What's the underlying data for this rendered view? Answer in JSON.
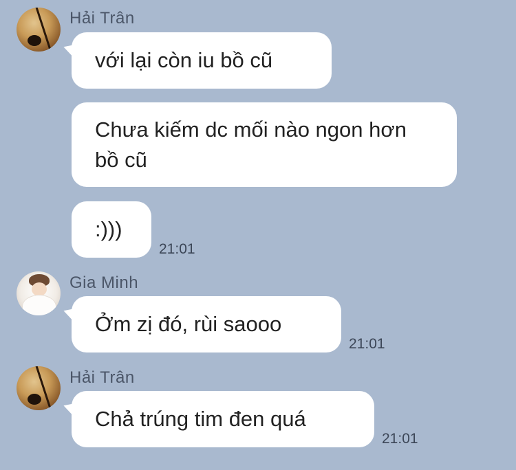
{
  "messages": [
    {
      "sender": "Hải Trân",
      "text": "với lại còn iu bồ cũ"
    },
    {
      "text": "Chưa kiếm dc mối nào ngon hơn bồ cũ"
    },
    {
      "text": ":)))",
      "time": "21:01"
    },
    {
      "sender": "Gia Minh",
      "text": "Ởm zị đó, rùi saooo",
      "time": "21:01"
    },
    {
      "sender": "Hải Trân",
      "text": "Chả trúng tim đen quá",
      "time": "21:01"
    }
  ],
  "avatars": {
    "hai_tran": "avatar-photo-brown",
    "gia_minh": "avatar-photo-white"
  },
  "colors": {
    "background": "#a9b9cf",
    "bubble": "#ffffff",
    "name_text": "#4b5668"
  }
}
